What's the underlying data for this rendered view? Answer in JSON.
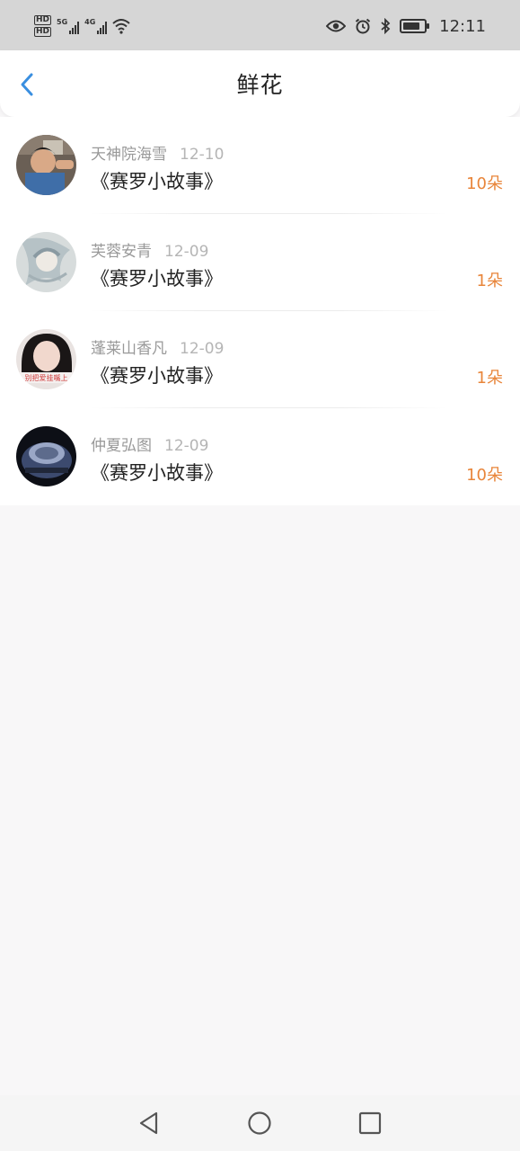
{
  "status_bar": {
    "hd1": "HD",
    "hd2": "HD",
    "net1": "5G",
    "net2": "4G",
    "time": "12:11",
    "icons": [
      "eye-icon",
      "alarm-icon",
      "bluetooth-icon",
      "battery-icon"
    ]
  },
  "header": {
    "title": "鲜花",
    "back_icon": "chevron-left-icon"
  },
  "flowers": [
    {
      "name": "天神院海雪",
      "date": "12-10",
      "book": "《赛罗小故事》",
      "amount": "10朵"
    },
    {
      "name": "芙蓉安青",
      "date": "12-09",
      "book": "《赛罗小故事》",
      "amount": "1朵"
    },
    {
      "name": "蓬莱山香凡",
      "date": "12-09",
      "book": "《赛罗小故事》",
      "amount": "1朵"
    },
    {
      "name": "仲夏弘图",
      "date": "12-09",
      "book": "《赛罗小故事》",
      "amount": "10朵"
    }
  ],
  "avatar_overlay_text": "别把爱挂嘴上",
  "colors": {
    "accent_blue": "#3a8fe0",
    "amount_orange": "#e8853a"
  },
  "nav": {
    "icons": [
      "back-triangle-icon",
      "home-circle-icon",
      "recents-square-icon"
    ]
  }
}
